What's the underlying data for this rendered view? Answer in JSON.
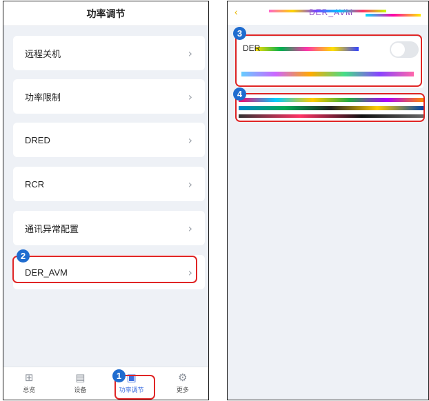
{
  "left": {
    "title": "功率调节",
    "menu": [
      {
        "label": "远程关机"
      },
      {
        "label": "功率限制"
      },
      {
        "label": "DRED"
      },
      {
        "label": "RCR"
      },
      {
        "label": "通讯异常配置"
      },
      {
        "label": "DER_AVM"
      }
    ],
    "chevron": "›",
    "tabs": [
      {
        "label": "总览",
        "icon": "grid-icon",
        "glyph": "⊞"
      },
      {
        "label": "设备",
        "icon": "device-icon",
        "glyph": "▤"
      },
      {
        "label": "功率调节",
        "icon": "power-adjust-icon",
        "glyph": "▣"
      },
      {
        "label": "更多",
        "icon": "gear-icon",
        "glyph": "⚙"
      }
    ],
    "active_tab": "功率调节"
  },
  "right": {
    "back": "‹",
    "title": "DER_AVM",
    "der_label": "DER"
  },
  "annotations": [
    "1",
    "2",
    "3",
    "4"
  ],
  "colors": {
    "accent": "#3d6fe0",
    "highlight": "#e02525",
    "badge": "#1f6ccf"
  }
}
